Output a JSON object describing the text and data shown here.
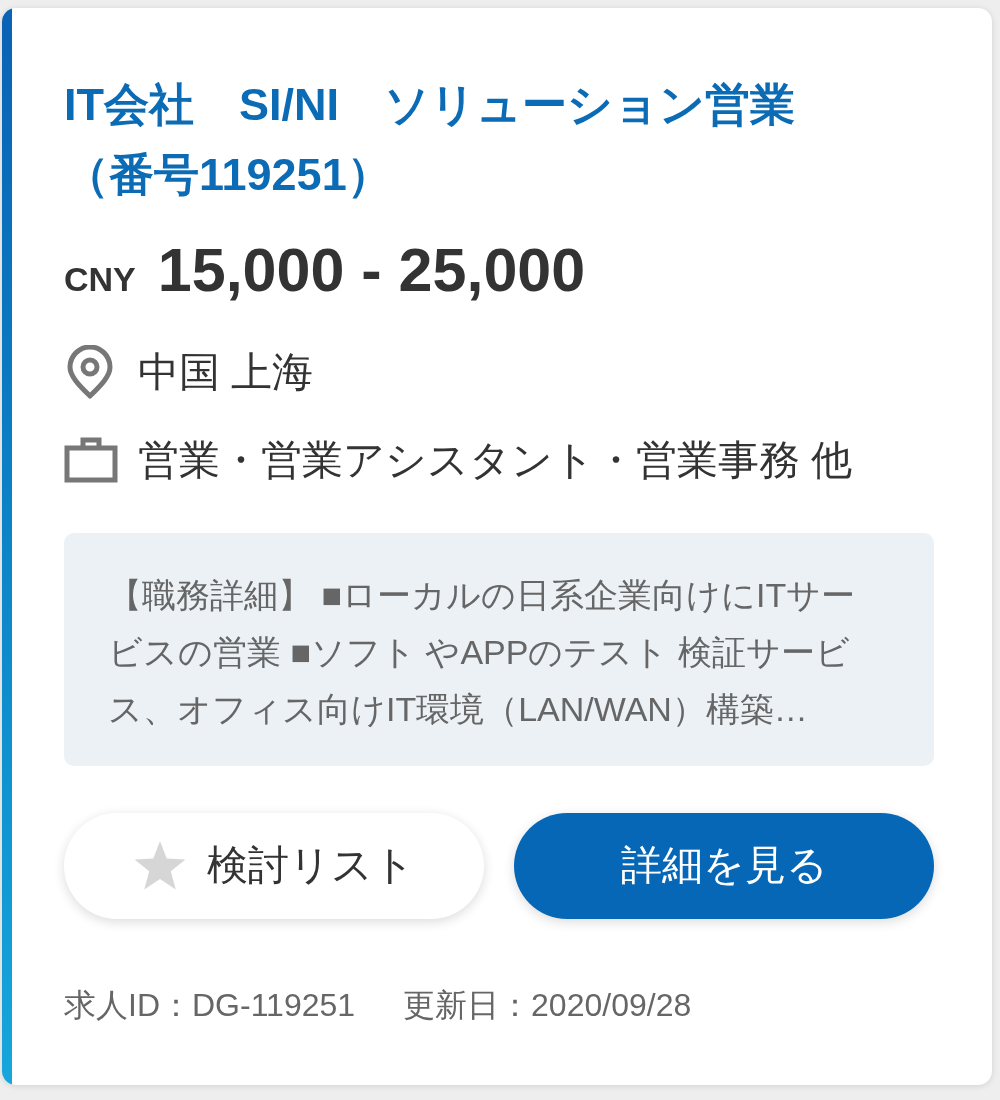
{
  "job": {
    "title": "IT会社　SI/NI　ソリューション営業（番号119251）",
    "salary": {
      "currency": "CNY",
      "range": "15,000 - 25,000"
    },
    "location": "中国 上海",
    "category": "営業・営業アシスタント・営業事務 他",
    "description": "【職務詳細】 ■ローカルの日系企業向けにITサービスの営業 ■ソフト やAPPのテスト 検証サービス、オフィス向けIT環境（LAN/WAN）構築…"
  },
  "actions": [
    {
      "kind": "save",
      "label": "検討リスト",
      "starred": false
    },
    {
      "kind": "detail",
      "label": "詳細を見る"
    }
  ],
  "footer": [
    "求人ID：DG-119251",
    "更新日：2020/09/28"
  ]
}
